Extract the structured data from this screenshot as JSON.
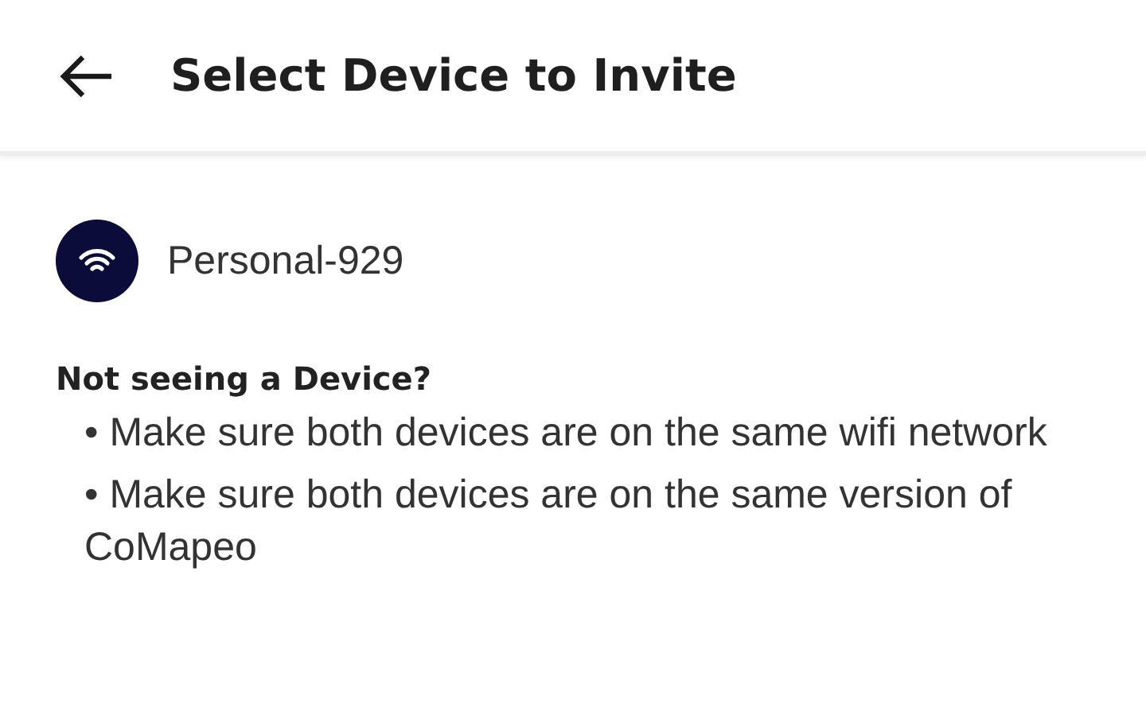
{
  "header": {
    "title": "Select Device to Invite"
  },
  "devices": [
    {
      "name": "Personal-929"
    }
  ],
  "help": {
    "title": "Not seeing a Device?",
    "tips": [
      "• Make sure both devices are on the same wifi network",
      "• Make sure both devices are on the same version of CoMapeo"
    ]
  }
}
